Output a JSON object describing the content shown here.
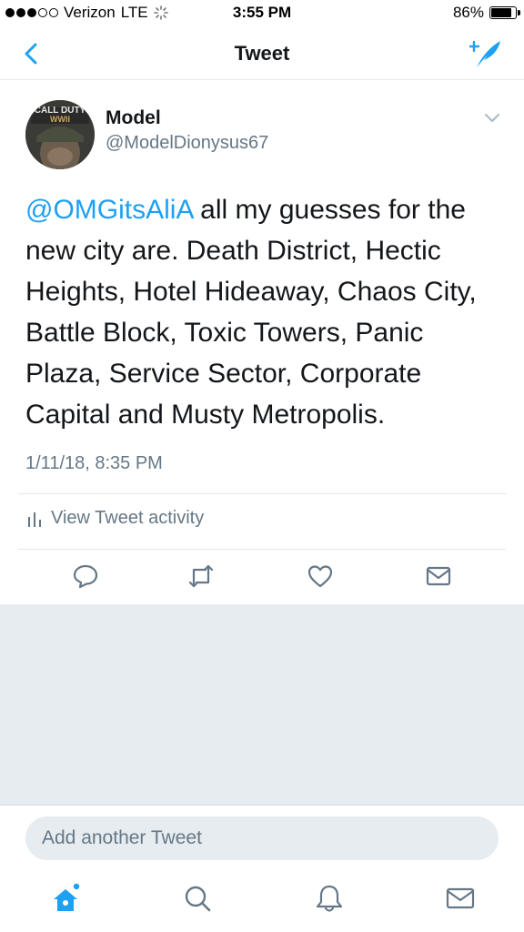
{
  "status_bar": {
    "carrier": "Verizon",
    "network": "LTE",
    "time": "3:55 PM",
    "battery": "86%",
    "battery_level": 0.86
  },
  "nav": {
    "title": "Tweet"
  },
  "tweet": {
    "author_name": "Model",
    "author_handle": "@ModelDionysus67",
    "avatar_text_1": "CALL DUTY",
    "avatar_text_2": "WWII",
    "mention": "@OMGitsAliA",
    "body": " all my guesses for the new city are. Death District, Hectic Heights, Hotel Hideaway, Chaos City, Battle Block, Toxic Towers, Panic Plaza, Service Sector, Corporate Capital and Musty Metropolis.",
    "timestamp": "1/11/18, 8:35 PM",
    "activity_label": "View Tweet activity"
  },
  "reply": {
    "placeholder": "Add another Tweet"
  },
  "colors": {
    "accent": "#1da1f2",
    "secondary_text": "#657786",
    "divider": "#e1e8ed",
    "background_gray": "#e6ecf0"
  },
  "icons": {
    "back": "chevron-left-icon",
    "compose": "compose-tweet-icon",
    "more": "chevron-down-icon",
    "activity": "bar-chart-icon",
    "reply": "reply-icon",
    "retweet": "retweet-icon",
    "like": "heart-icon",
    "dm": "envelope-icon",
    "home": "home-icon",
    "search": "search-icon",
    "notifications": "bell-icon",
    "messages": "envelope-icon"
  }
}
